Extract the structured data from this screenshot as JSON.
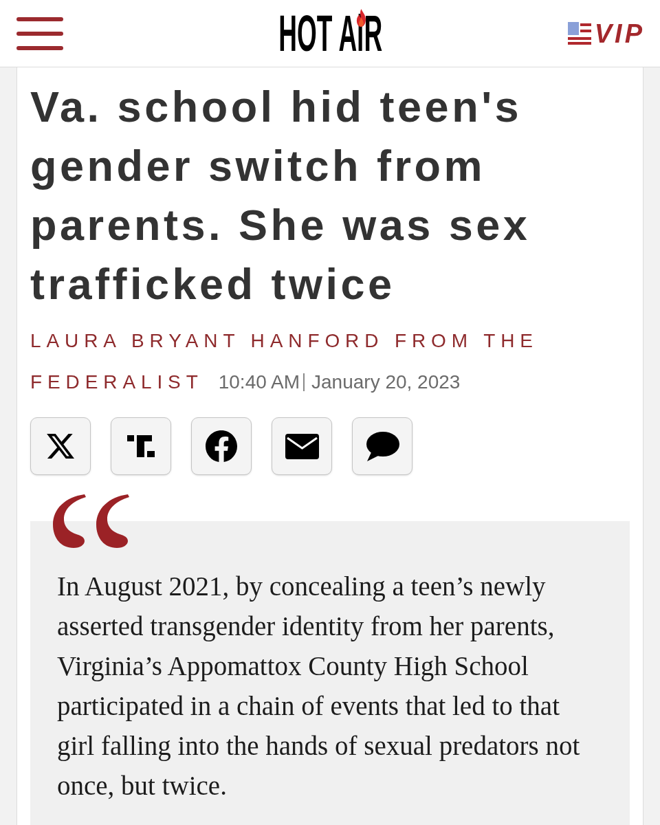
{
  "header": {
    "logo": "HOT AiR",
    "vip": "VIP"
  },
  "article": {
    "headline": "Va. school hid teen's gender switch from parents. She was sex trafficked twice",
    "author": "LAURA BRYANT HANFORD FROM THE FEDERALIST",
    "time": "10:40 AM",
    "date": "January 20, 2023",
    "share_buttons": [
      {
        "kind": "x"
      },
      {
        "kind": "t"
      },
      {
        "kind": "f"
      },
      {
        "kind": "mail"
      },
      {
        "kind": "chat"
      }
    ],
    "quote": {
      "text": "In August 2021, by concealing a teen’s newly asserted transgender identity from her parents, Virginia’s Appomattox County High School participated in a chain of events that led to that girl falling into the hands of sexual predators not once, but twice."
    }
  }
}
